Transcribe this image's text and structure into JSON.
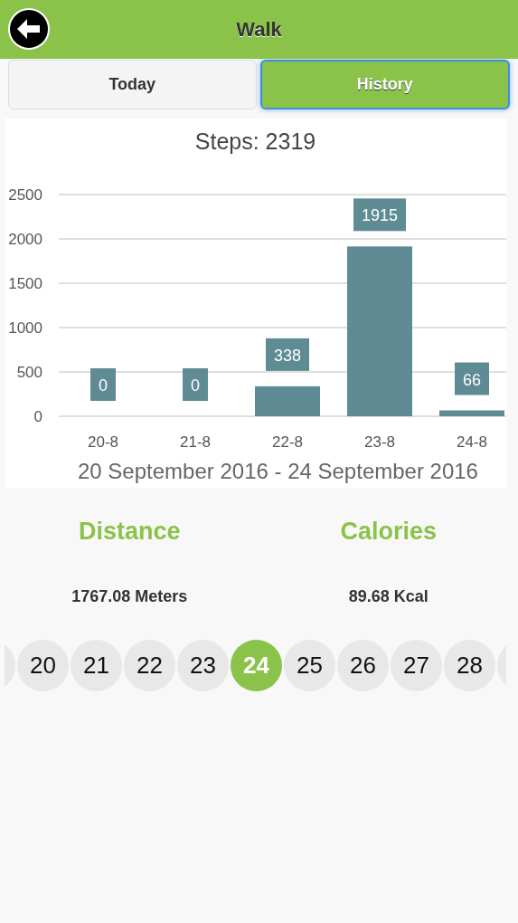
{
  "header": {
    "title": "Walk"
  },
  "tabs": [
    {
      "label": "Today",
      "selected": false
    },
    {
      "label": "History",
      "selected": true
    }
  ],
  "chart": {
    "title": "Steps: 2319",
    "date_range": "20 September 2016 - 24 September 2016",
    "chart_data": {
      "type": "bar",
      "categories": [
        "20-8",
        "21-8",
        "22-8",
        "23-8",
        "24-8"
      ],
      "series": [
        {
          "color": "#5f8b94",
          "values": [
            0,
            0,
            338,
            1915,
            66
          ]
        }
      ],
      "ylim": [
        0,
        2500
      ],
      "yticks": [
        0,
        500,
        1000,
        1500,
        2000,
        2500
      ],
      "data_labels": true,
      "grid": true
    }
  },
  "stats": [
    {
      "label": "Distance",
      "value": "1767.08 Meters"
    },
    {
      "label": "Calories",
      "value": "89.68 Kcal"
    }
  ],
  "days": [
    {
      "label": "20",
      "selected": false
    },
    {
      "label": "21",
      "selected": false
    },
    {
      "label": "22",
      "selected": false
    },
    {
      "label": "23",
      "selected": false
    },
    {
      "label": "24",
      "selected": true
    },
    {
      "label": "25",
      "selected": false
    },
    {
      "label": "26",
      "selected": false
    },
    {
      "label": "27",
      "selected": false
    },
    {
      "label": "28",
      "selected": false
    }
  ]
}
